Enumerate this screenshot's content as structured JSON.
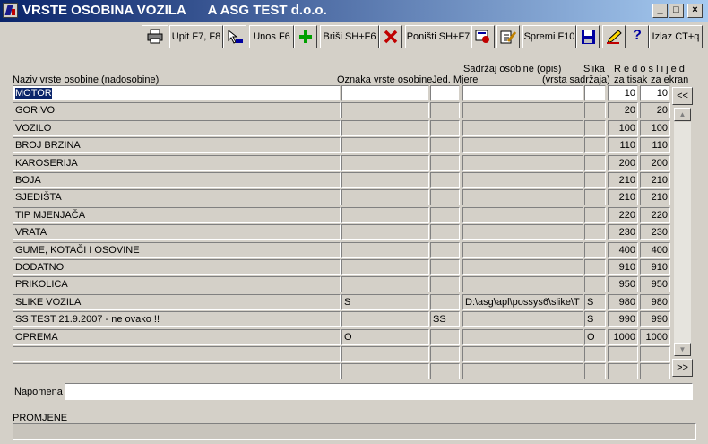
{
  "window": {
    "title": "VRSTE OSOBINA VOZILA      A ASG TEST d.o.o.",
    "min_label": "_",
    "max_label": "□",
    "close_label": "×"
  },
  "toolbar": {
    "upit": "Upit F7, F8",
    "unos": "Unos F6",
    "brisi": "Briši  SH+F6",
    "ponisti": "Poništi SH+F7",
    "spremi": "Spremi F10",
    "help": "?",
    "izlaz": "Izlaz CT+q"
  },
  "headers": {
    "naziv": "Naziv vrste osobine (nadosobine)",
    "oznaka": "Oznaka vrste osobine",
    "jed": "Jed. Mjere",
    "sadrzaj": "Sadržaj osobine (opis)",
    "vrsta_sadrzaja": "(vrsta sadržaja)",
    "slika": "Slika",
    "redoslijed": "R e d o s l i j e d",
    "za_tisak": "za tisak",
    "za_ekran": "za ekran"
  },
  "rows": [
    {
      "naziv": "MOTOR",
      "oznaka": "",
      "jed": "",
      "sadrzaj": "",
      "slika": "",
      "tisak": "10",
      "ekran": "10"
    },
    {
      "naziv": "GORIVO",
      "oznaka": "",
      "jed": "",
      "sadrzaj": "",
      "slika": "",
      "tisak": "20",
      "ekran": "20"
    },
    {
      "naziv": "VOZILO",
      "oznaka": "",
      "jed": "",
      "sadrzaj": "",
      "slika": "",
      "tisak": "100",
      "ekran": "100"
    },
    {
      "naziv": "BROJ BRZINA",
      "oznaka": "",
      "jed": "",
      "sadrzaj": "",
      "slika": "",
      "tisak": "110",
      "ekran": "110"
    },
    {
      "naziv": "KAROSERIJA",
      "oznaka": "",
      "jed": "",
      "sadrzaj": "",
      "slika": "",
      "tisak": "200",
      "ekran": "200"
    },
    {
      "naziv": "BOJA",
      "oznaka": "",
      "jed": "",
      "sadrzaj": "",
      "slika": "",
      "tisak": "210",
      "ekran": "210"
    },
    {
      "naziv": "SJEDIŠTA",
      "oznaka": "",
      "jed": "",
      "sadrzaj": "",
      "slika": "",
      "tisak": "210",
      "ekran": "210"
    },
    {
      "naziv": "TIP MJENJAČA",
      "oznaka": "",
      "jed": "",
      "sadrzaj": "",
      "slika": "",
      "tisak": "220",
      "ekran": "220"
    },
    {
      "naziv": "VRATA",
      "oznaka": "",
      "jed": "",
      "sadrzaj": "",
      "slika": "",
      "tisak": "230",
      "ekran": "230"
    },
    {
      "naziv": "GUME, KOTAČI I OSOVINE",
      "oznaka": "",
      "jed": "",
      "sadrzaj": "",
      "slika": "",
      "tisak": "400",
      "ekran": "400"
    },
    {
      "naziv": "DODATNO",
      "oznaka": "",
      "jed": "",
      "sadrzaj": "",
      "slika": "",
      "tisak": "910",
      "ekran": "910"
    },
    {
      "naziv": "PRIKOLICA",
      "oznaka": "",
      "jed": "",
      "sadrzaj": "",
      "slika": "",
      "tisak": "950",
      "ekran": "950"
    },
    {
      "naziv": "SLIKE VOZILA",
      "oznaka": "S",
      "jed": "",
      "sadrzaj": "D:\\asg\\apl\\possys6\\slike\\T",
      "slika": "S",
      "tisak": "980",
      "ekran": "980"
    },
    {
      "naziv": "SS TEST 21.9.2007 - ne ovako !!",
      "oznaka": "",
      "jed": "SS",
      "sadrzaj": "",
      "slika": "S",
      "tisak": "990",
      "ekran": "990"
    },
    {
      "naziv": "OPREMA",
      "oznaka": "O",
      "jed": "",
      "sadrzaj": "",
      "slika": "O",
      "tisak": "1000",
      "ekran": "1000"
    },
    {
      "naziv": "",
      "oznaka": "",
      "jed": "",
      "sadrzaj": "",
      "slika": "",
      "tisak": "",
      "ekran": ""
    },
    {
      "naziv": "",
      "oznaka": "",
      "jed": "",
      "sadrzaj": "",
      "slika": "",
      "tisak": "",
      "ekran": ""
    }
  ],
  "nav": {
    "prev": "<<",
    "next": ">>"
  },
  "footer": {
    "napomena_label": "Napomena",
    "napomena_value": "",
    "promjene_label": "PROMJENE",
    "promjene_value": ""
  },
  "colors": {
    "titlebar_start": "#0a246a",
    "titlebar_end": "#a6caf0",
    "face": "#d4d0c8",
    "selection": "#0a246a"
  }
}
